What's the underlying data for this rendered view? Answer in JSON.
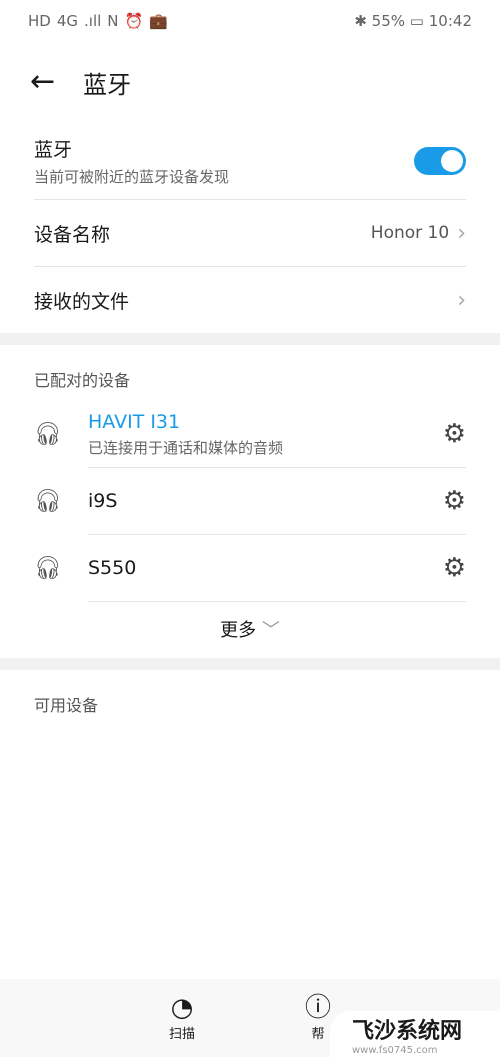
{
  "status": {
    "left": [
      "HD",
      "4G",
      ".ıll",
      "N",
      "⏰",
      "💼"
    ],
    "battery": "55%",
    "time": "10:42"
  },
  "header": {
    "title": "蓝牙"
  },
  "bluetooth": {
    "label": "蓝牙",
    "sub": "当前可被附近的蓝牙设备发现",
    "enabled": true
  },
  "device_name": {
    "label": "设备名称",
    "value": "Honor 10"
  },
  "received": {
    "label": "接收的文件"
  },
  "paired": {
    "title": "已配对的设备",
    "devices": [
      {
        "name": "HAVIT I31",
        "status": "已连接用于通话和媒体的音频",
        "connected": true
      },
      {
        "name": "i9S"
      },
      {
        "name": "S550"
      }
    ],
    "more": "更多"
  },
  "available": {
    "title": "可用设备"
  },
  "bottom": {
    "scan": "扫描",
    "help": "帮"
  },
  "watermark": {
    "name": "飞沙系统网",
    "url": "www.fs0745.com"
  },
  "colors": {
    "accent": "#1a9be8"
  }
}
